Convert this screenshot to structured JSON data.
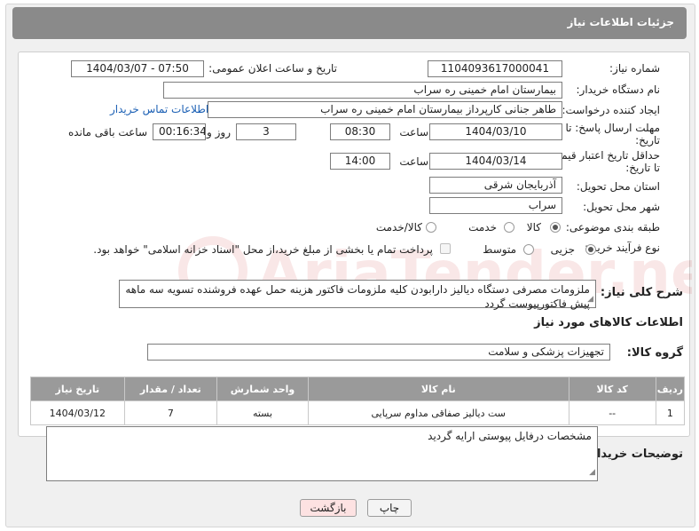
{
  "header": {
    "title": "جزئیات اطلاعات نیاز"
  },
  "fields": {
    "need_number_label": "شماره نیاز:",
    "need_number": "1104093617000041",
    "announce_label": "تاریخ و ساعت اعلان عمومی:",
    "announce_value": "1404/03/07 - 07:50",
    "buyer_org_label": "نام دستگاه خریدار:",
    "buyer_org": "بیمارستان امام خمینی ره  سراب",
    "creator_label": "ایجاد کننده درخواست:",
    "creator": "طاهر جنانی کارپرداز بیمارستان امام خمینی ره  سراب",
    "contact_link": "اطلاعات تماس خریدار",
    "deadline_label_1": "مهلت ارسال پاسخ: تا",
    "deadline_label_2": "تاریخ:",
    "deadline_date": "1404/03/10",
    "time_word": "ساعت",
    "deadline_time": "08:30",
    "days_value": "3",
    "days_word": "روز و",
    "remaining_time": "00:16:34",
    "remaining_word": "ساعت باقی مانده",
    "min_price_label_1": "حداقل تاریخ اعتبار قیمت:",
    "min_price_label_2": "تا تاریخ:",
    "validity_date": "1404/03/14",
    "validity_time": "14:00",
    "province_label": "استان محل تحویل:",
    "province": "آذربایجان شرقی",
    "city_label": "شهر محل تحویل:",
    "city": "سراب",
    "category_label": "طبقه بندی موضوعی:",
    "category_options": [
      "کالا",
      "خدمت",
      "کالا/خدمت"
    ],
    "process_label": "نوع فرآیند خرید :",
    "process_options": [
      "جزیی",
      "متوسط"
    ],
    "payment_note": "پرداخت تمام یا بخشی از مبلغ خرید،از محل \"اسناد خزانه اسلامی\" خواهد بود.",
    "summary_label": "شرح کلی نیاز:",
    "summary_text": "ملزومات مصرفی دستگاه دیالیز دارابودن کلیه ملزومات فاکتور هزینه حمل عهده فروشنده تسویه سه ماهه پیش فاکتورپیوست گردد",
    "goods_info_title": "اطلاعات کالاهای مورد نیاز",
    "goods_group_label": "گروه کالا:",
    "goods_group": "تجهیزات پزشکی و سلامت"
  },
  "table": {
    "headers": [
      "ردیف",
      "کد کالا",
      "نام کالا",
      "واحد شمارش",
      "تعداد / مقدار",
      "تاریخ نیاز"
    ],
    "rows": [
      [
        "1",
        "--",
        "ست دیالیز صفاقی مداوم سرپایی",
        "بسته",
        "7",
        "1404/03/12"
      ]
    ]
  },
  "notes": {
    "label": "توضیحات خریدار:",
    "text": "مشخصات درفایل پیوستی ارایه گردید"
  },
  "buttons": {
    "print": "چاپ",
    "back": "بازگشت"
  },
  "watermark": {
    "text": "AriaTender.neT"
  }
}
